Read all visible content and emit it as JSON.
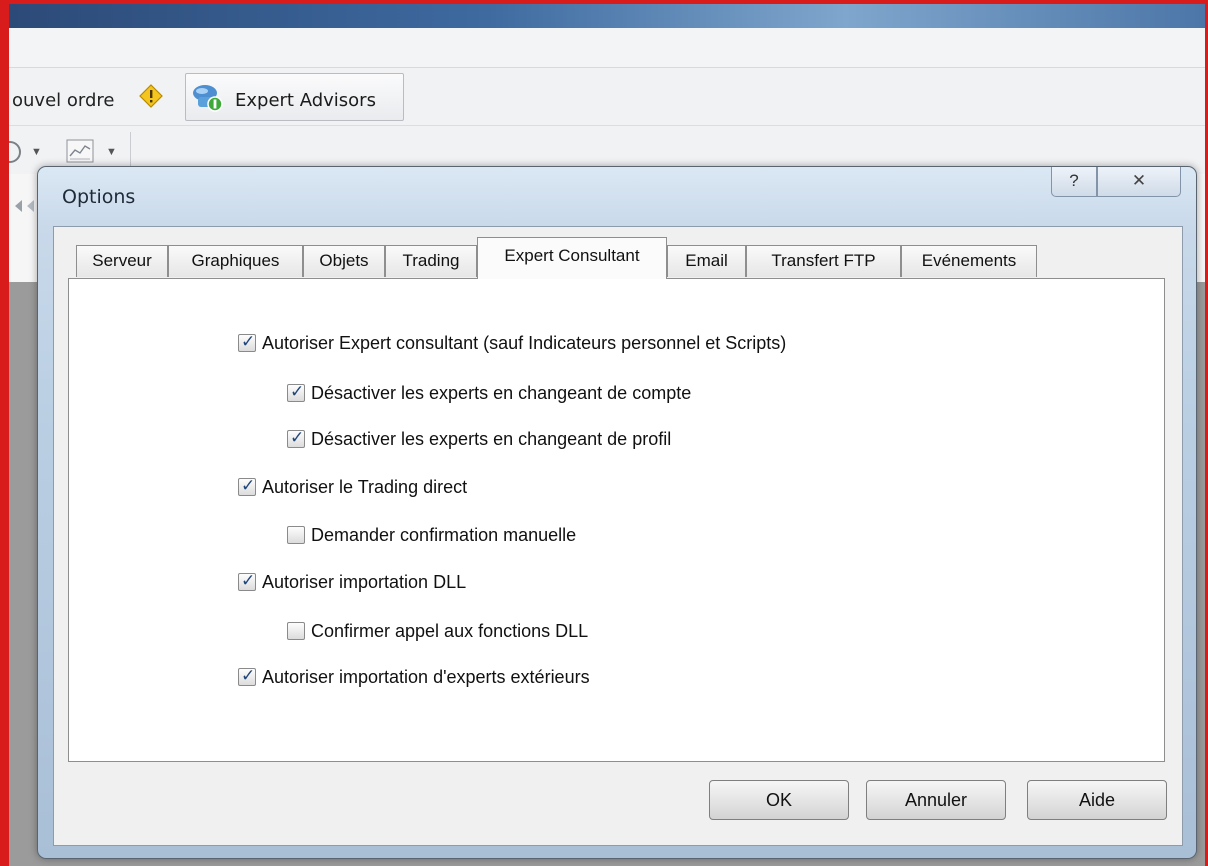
{
  "toolbar": {
    "new_order_label": "ouvel ordre",
    "expert_advisors_label": "Expert Advisors"
  },
  "dialog": {
    "title": "Options",
    "help_glyph": "?",
    "close_glyph": "✕",
    "tabs": [
      {
        "label": "Serveur",
        "active": false
      },
      {
        "label": "Graphiques",
        "active": false
      },
      {
        "label": "Objets",
        "active": false
      },
      {
        "label": "Trading",
        "active": false
      },
      {
        "label": "Expert Consultant",
        "active": true
      },
      {
        "label": "Email",
        "active": false
      },
      {
        "label": "Transfert FTP",
        "active": false
      },
      {
        "label": "Evénements",
        "active": false
      }
    ],
    "options": [
      {
        "label": "Autoriser Expert consultant (sauf Indicateurs personnel et Scripts)",
        "checked": true
      },
      {
        "label": "Désactiver les experts en changeant de compte",
        "checked": true
      },
      {
        "label": "Désactiver les experts en changeant de profil",
        "checked": true
      },
      {
        "label": "Autoriser le Trading direct",
        "checked": true
      },
      {
        "label": "Demander confirmation manuelle",
        "checked": false
      },
      {
        "label": "Autoriser importation DLL",
        "checked": true
      },
      {
        "label": "Confirmer appel aux fonctions DLL",
        "checked": false
      },
      {
        "label": "Autoriser importation d'experts extérieurs",
        "checked": true
      }
    ],
    "buttons": {
      "ok": "OK",
      "cancel": "Annuler",
      "help": "Aide"
    }
  },
  "colors": {
    "frame": "#d81b1b",
    "checkmark": "#20467a"
  }
}
